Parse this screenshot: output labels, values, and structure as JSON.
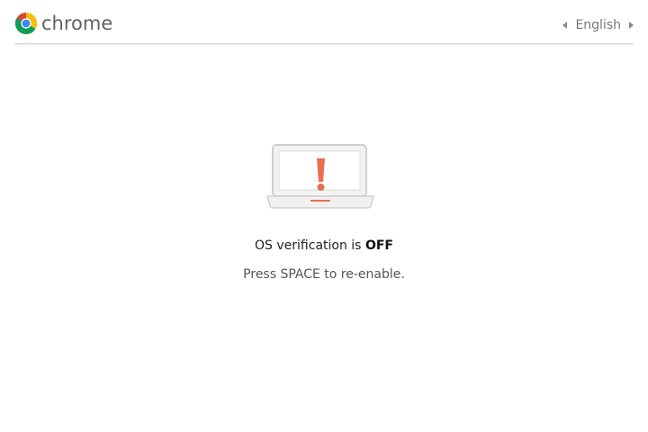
{
  "header": {
    "brand": "chrome",
    "brand_icon": "chrome-logo-icon",
    "language": "English",
    "prev_icon": "triangle-left-icon",
    "next_icon": "triangle-right-icon"
  },
  "main": {
    "illustration_icon": "laptop-warning-icon",
    "title_prefix": "OS verification is ",
    "title_status": "OFF",
    "subtitle": "Press SPACE to re-enable."
  },
  "colors": {
    "warning": "#e8704f",
    "chrome_red": "#db4437",
    "chrome_yellow": "#f4c20d",
    "chrome_green": "#0f9d58",
    "chrome_blue": "#4285f4"
  }
}
